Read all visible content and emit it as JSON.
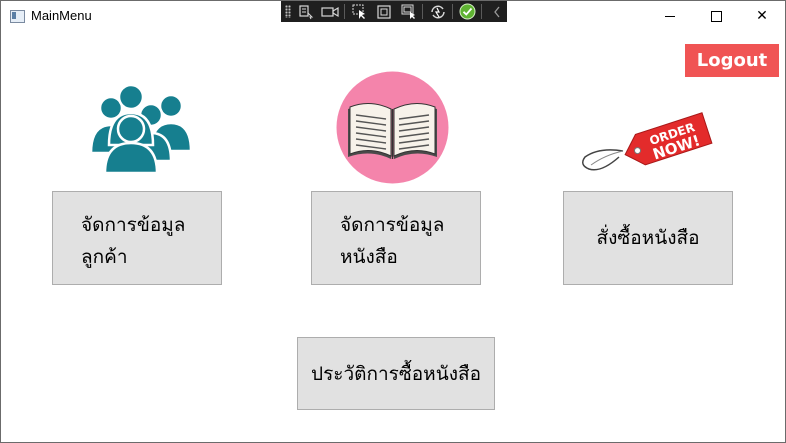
{
  "window": {
    "title": "MainMenu",
    "controls": {
      "minimize": "minimize-icon",
      "maximize": "maximize-icon",
      "close": "✕"
    }
  },
  "devtools_toolbar": {
    "icons": [
      "select-element-icon",
      "record-icon",
      "pointer-icon",
      "layout-adorner-icon",
      "track-focus-icon",
      "hot-reload-icon",
      "check-icon",
      "collapse-icon"
    ]
  },
  "header": {
    "logout_label": "Logout"
  },
  "menu": {
    "customers_line1": "จัดการข้อมูล",
    "customers_line2": "ลูกค้า",
    "books_line1": "จัดการข้อมูล",
    "books_line2": "หนังสือ",
    "order_label": "สั่งซื้อหนังสือ",
    "history_label": "ประวัติการซื้อหนังสือ"
  },
  "order_tag": {
    "line1": "ORDER",
    "line2": "NOW!"
  },
  "colors": {
    "logout_bg": "#f05454",
    "button_bg": "#e1e1e1",
    "button_border": "#adadad",
    "people_icon": "#167f8f",
    "book_circle": "#f484ab",
    "order_tag": "#e32b2b",
    "devbar_bg": "#1f1f1f",
    "check_green": "#5fb332"
  }
}
